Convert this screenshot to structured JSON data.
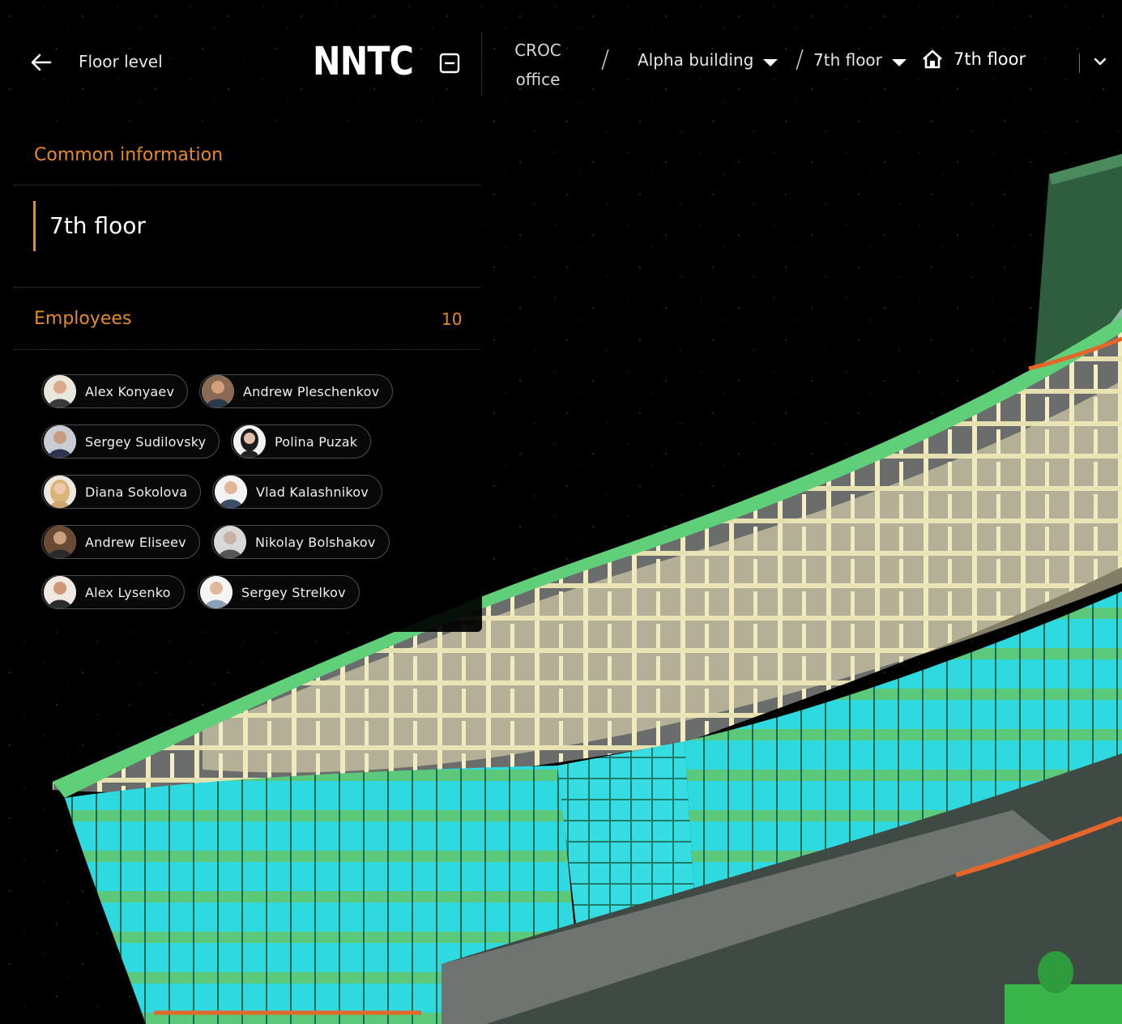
{
  "header": {
    "back_label": "Floor level",
    "logo": "NNTC",
    "breadcrumb": {
      "org_line1": "CROC",
      "org_line2": "office",
      "separator": "/",
      "building": "Alpha building",
      "floor": "7th floor",
      "current": "7th floor"
    }
  },
  "panel": {
    "common_title": "Common information",
    "floor_name": "7th floor",
    "employees_title": "Employees",
    "employees_count": "10",
    "employees": [
      "Alex Konyaev",
      "Andrew Pleschenkov",
      "Sergey Sudilovsky",
      "Polina Puzak",
      "Diana Sokolova",
      "Vlad Kalashnikov",
      "Andrew Eliseev",
      "Nikolay Bolshakov",
      "Alex Lysenko",
      "Sergey Strelkov"
    ]
  },
  "colors": {
    "accent": "#e58a2b",
    "background": "#000000",
    "building_frame": "#5fcf7a",
    "glass": "#34e0e6",
    "interior_walls": "#f2ecc0",
    "floor": "#6b6e6c"
  }
}
